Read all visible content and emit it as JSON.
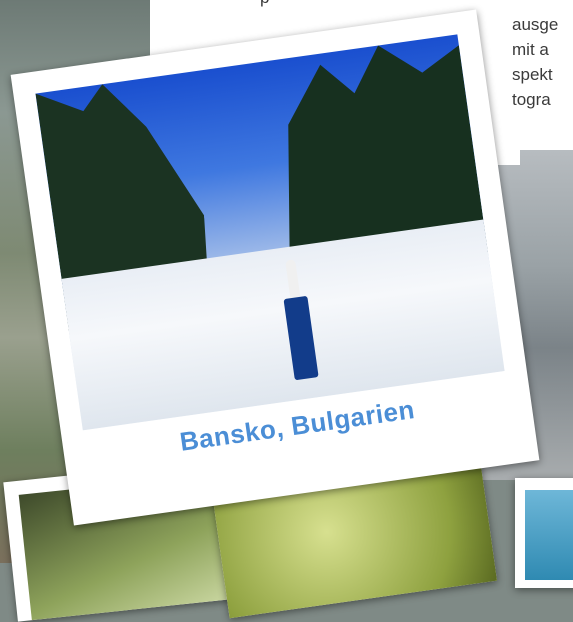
{
  "text_lines": [
    "ausge",
    "mit a",
    "spekt",
    "togra"
  ],
  "top_text": "p",
  "main_photo": {
    "caption": "Bansko, Bulgarien",
    "caption_color": "#4b8ed6"
  }
}
